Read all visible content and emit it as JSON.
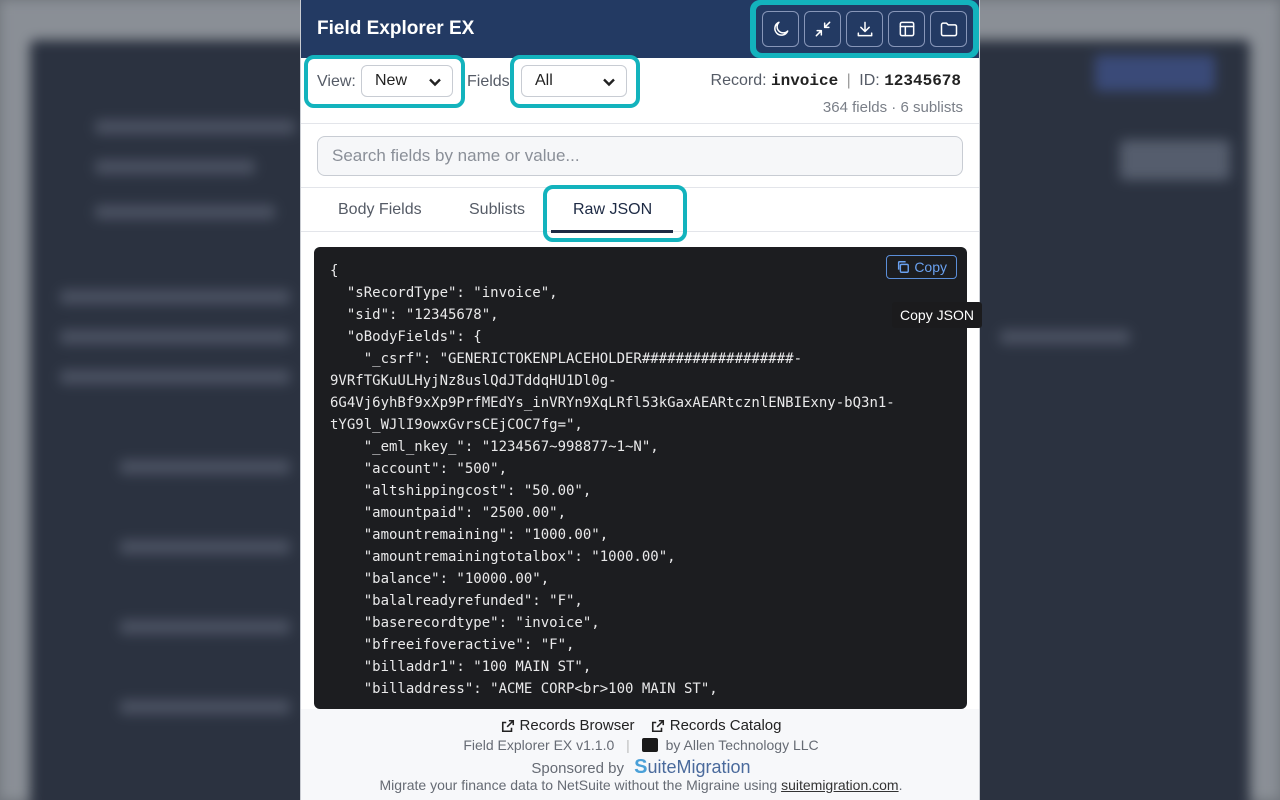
{
  "app": {
    "title": "Field Explorer EX"
  },
  "header_icons": [
    "moon-icon",
    "collapse-icon",
    "download-icon",
    "table-icon",
    "folder-icon"
  ],
  "controls": {
    "view_label": "View:",
    "view_value": "New",
    "fields_label": "Fields",
    "fields_value": "All",
    "record_label": "Record:",
    "record_type": "invoice",
    "id_label": "ID:",
    "record_id": "12345678",
    "counts": "364 fields · 6 sublists"
  },
  "search": {
    "placeholder": "Search fields by name or value..."
  },
  "tabs": [
    "Body Fields",
    "Sublists",
    "Raw JSON"
  ],
  "code": {
    "copy_label": "Copy",
    "tooltip": "Copy JSON",
    "lines": [
      "{",
      "  \"sRecordType\": \"invoice\",",
      "  \"sid\": \"12345678\",",
      "  \"oBodyFields\": {",
      "    \"_csrf\": \"GENERICTOKENPLACEHOLDER##################-",
      "9VRfTGKuULHyjNz8uslQdJTddqHU1Dl0g-",
      "6G4Vj6yhBf9xXp9PrfMEdYs_inVRYn9XqLRfl53kGaxAEARtcznlENBIExny-bQ3n1-",
      "tYG9l_WJlI9owxGvrsCEjCOC7fg=\",",
      "    \"_eml_nkey_\": \"1234567~998877~1~N\",",
      "    \"account\": \"500\",",
      "    \"altshippingcost\": \"50.00\",",
      "    \"amountpaid\": \"2500.00\",",
      "    \"amountremaining\": \"1000.00\",",
      "    \"amountremainingtotalbox\": \"1000.00\",",
      "    \"balance\": \"10000.00\",",
      "    \"balalreadyrefunded\": \"F\",",
      "    \"baserecordtype\": \"invoice\",",
      "    \"bfreeifoveractive\": \"F\",",
      "    \"billaddr1\": \"100 MAIN ST\",",
      "    \"billaddress\": \"ACME CORP<br>100 MAIN ST\","
    ]
  },
  "footer": {
    "link1": "Records Browser",
    "link2": "Records Catalog",
    "version": "Field Explorer EX v1.1.0",
    "by": "by Allen Technology LLC",
    "sponsored": "Sponsored by",
    "brand_s": "S",
    "brand_rest": "uiteMigration",
    "tagline_pre": "Migrate your finance data to NetSuite without the Migraine using ",
    "tagline_link": "suitemigration.com",
    "tagline_post": "."
  },
  "colors": {
    "header": "#233a63",
    "highlight": "#13b3bd",
    "code_bg": "#1c1d20"
  }
}
